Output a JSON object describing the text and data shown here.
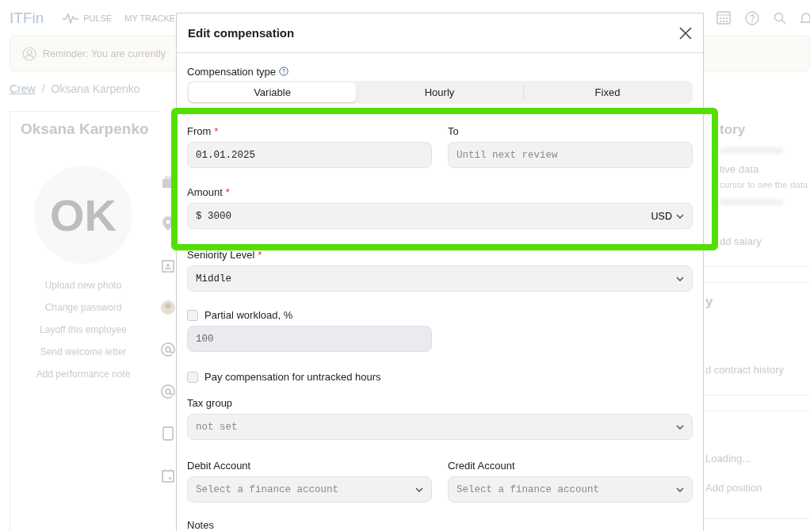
{
  "app": {
    "logo": "ITFin",
    "nav": [
      {
        "label": "PULSE",
        "kind": "pulse"
      },
      {
        "label": "MY TRACKE",
        "kind": "plain"
      }
    ]
  },
  "reminder": "Reminder: You are currently",
  "breadcrumb": {
    "link": "Crew",
    "separator": "/",
    "current": "Oksana Karpenko"
  },
  "profile": {
    "name": "Oksana Karpenko",
    "initials": "OK",
    "actions": [
      "Upload new photo",
      "Change password",
      "Layoff this employee",
      "Send welcome letter",
      "Add performance note"
    ]
  },
  "side_panel": {
    "sections": [
      {
        "lines": [
          {
            "kind": "heading",
            "text": "tory"
          },
          {
            "kind": "blur"
          },
          {
            "kind": "text",
            "text": "tive data"
          },
          {
            "kind": "hint",
            "text": "cursor to see the data"
          },
          {
            "kind": "blur"
          },
          {
            "kind": "action",
            "text": "dd salary"
          }
        ]
      },
      {
        "lines": [
          {
            "kind": "heading",
            "text": "y"
          },
          {
            "kind": "action",
            "text": "d contract history"
          }
        ]
      },
      {
        "lines": [
          {
            "kind": "text",
            "text": "Loading..."
          },
          {
            "kind": "action",
            "text": "Add position"
          }
        ]
      }
    ]
  },
  "dialog": {
    "title": "Edit compensation",
    "compensation_type": {
      "label": "Compensation type",
      "options": [
        {
          "label": "Variable",
          "selected": true
        },
        {
          "label": "Hourly",
          "selected": false
        },
        {
          "label": "Fixed",
          "selected": false
        }
      ]
    },
    "from": {
      "label": "From",
      "required_mark": "*",
      "value": "01.01.2025"
    },
    "to": {
      "label": "To",
      "placeholder": "Until next review"
    },
    "amount": {
      "label": "Amount",
      "required_mark": "*",
      "prefix": "$",
      "value": "3000",
      "currency": "USD"
    },
    "seniority": {
      "label": "Seniority Level",
      "required_mark": "*",
      "value": "Middle"
    },
    "partial_workload": {
      "label": "Partial workload, %",
      "checked": false,
      "value": "100"
    },
    "untracked": {
      "label": "Pay compensation for untracked hours",
      "checked": false
    },
    "tax_group": {
      "label": "Tax group",
      "placeholder": "not set"
    },
    "debit": {
      "label": "Debit Account",
      "placeholder": "Select a finance account"
    },
    "credit": {
      "label": "Credit Account",
      "placeholder": "Select a finance account"
    },
    "notes": {
      "label": "Notes"
    }
  }
}
